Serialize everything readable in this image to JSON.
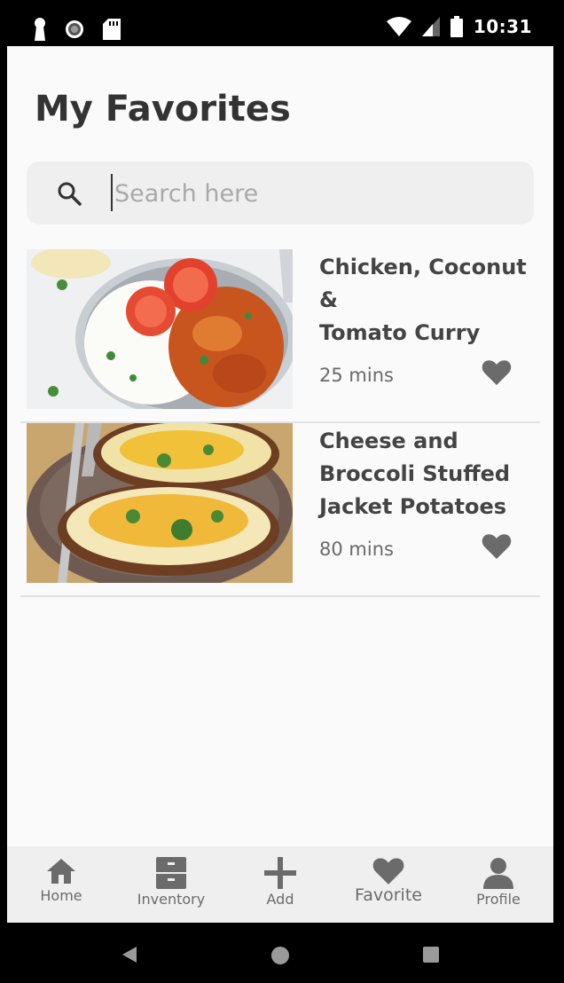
{
  "status_bar": {
    "time": "10:31"
  },
  "page": {
    "title": "My Favorites"
  },
  "search": {
    "placeholder": "Search here",
    "value": ""
  },
  "recipes": [
    {
      "title_lines": [
        "Chicken, Coconut &",
        "Tomato Curry"
      ],
      "time": "25 mins",
      "favorite": true
    },
    {
      "title_lines": [
        "Cheese and",
        "Broccoli Stuffed",
        "Jacket Potatoes"
      ],
      "time": "80 mins",
      "favorite": true
    }
  ],
  "bottom_nav": {
    "items": [
      {
        "label": "Home",
        "icon": "home-icon"
      },
      {
        "label": "Inventory",
        "icon": "inventory-icon"
      },
      {
        "label": "Add",
        "icon": "add-icon"
      },
      {
        "label": "Favorite",
        "icon": "heart-icon",
        "active": true
      },
      {
        "label": "Profile",
        "icon": "profile-icon"
      }
    ]
  },
  "colors": {
    "background": "#fafafa",
    "title_text": "#333333",
    "icon_gray": "#6b6b6b",
    "search_bg": "#efefef",
    "nav_bg": "#efefef"
  }
}
